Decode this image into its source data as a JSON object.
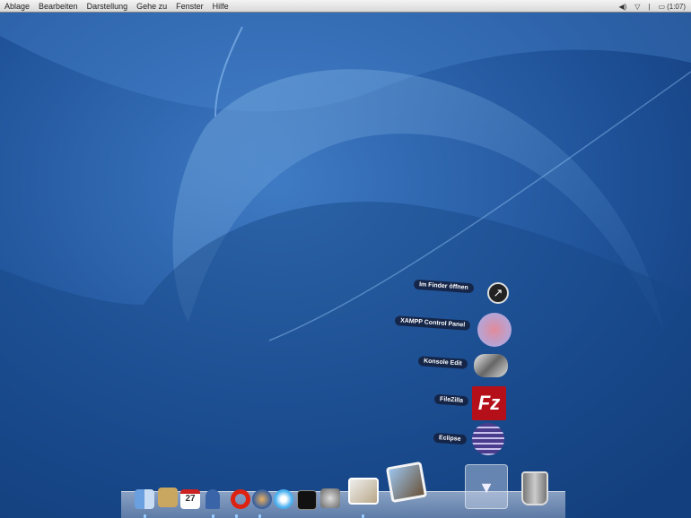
{
  "menubar": {
    "items": [
      "Ablage",
      "Bearbeiten",
      "Darstellung",
      "Gehe zu",
      "Fenster",
      "Hilfe"
    ],
    "status": {
      "battery": "(1:07)",
      "volume_icon": "speaker-icon",
      "wifi_icon": "wifi-icon"
    }
  },
  "stack": {
    "items": [
      {
        "label": "Im Finder öffnen",
        "icon": "arrow-icon"
      },
      {
        "label": "XAMPP Control Panel",
        "icon": "xampp-icon"
      },
      {
        "label": "Konsole Edit",
        "icon": "konsole-icon"
      },
      {
        "label": "FileZilla",
        "icon": "filezilla-icon",
        "glyph": "Fz"
      },
      {
        "label": "Eclipse",
        "icon": "eclipse-icon"
      }
    ]
  },
  "dock": {
    "items": [
      "finder",
      "mail",
      "ical",
      "address-book",
      "opera",
      "thunderbird",
      "itunes",
      "terminal",
      "system-preferences",
      "preview",
      "iphoto",
      "stack",
      "trash"
    ],
    "ical_day": "27"
  },
  "colors": {
    "desktop": "#1f4f94"
  }
}
